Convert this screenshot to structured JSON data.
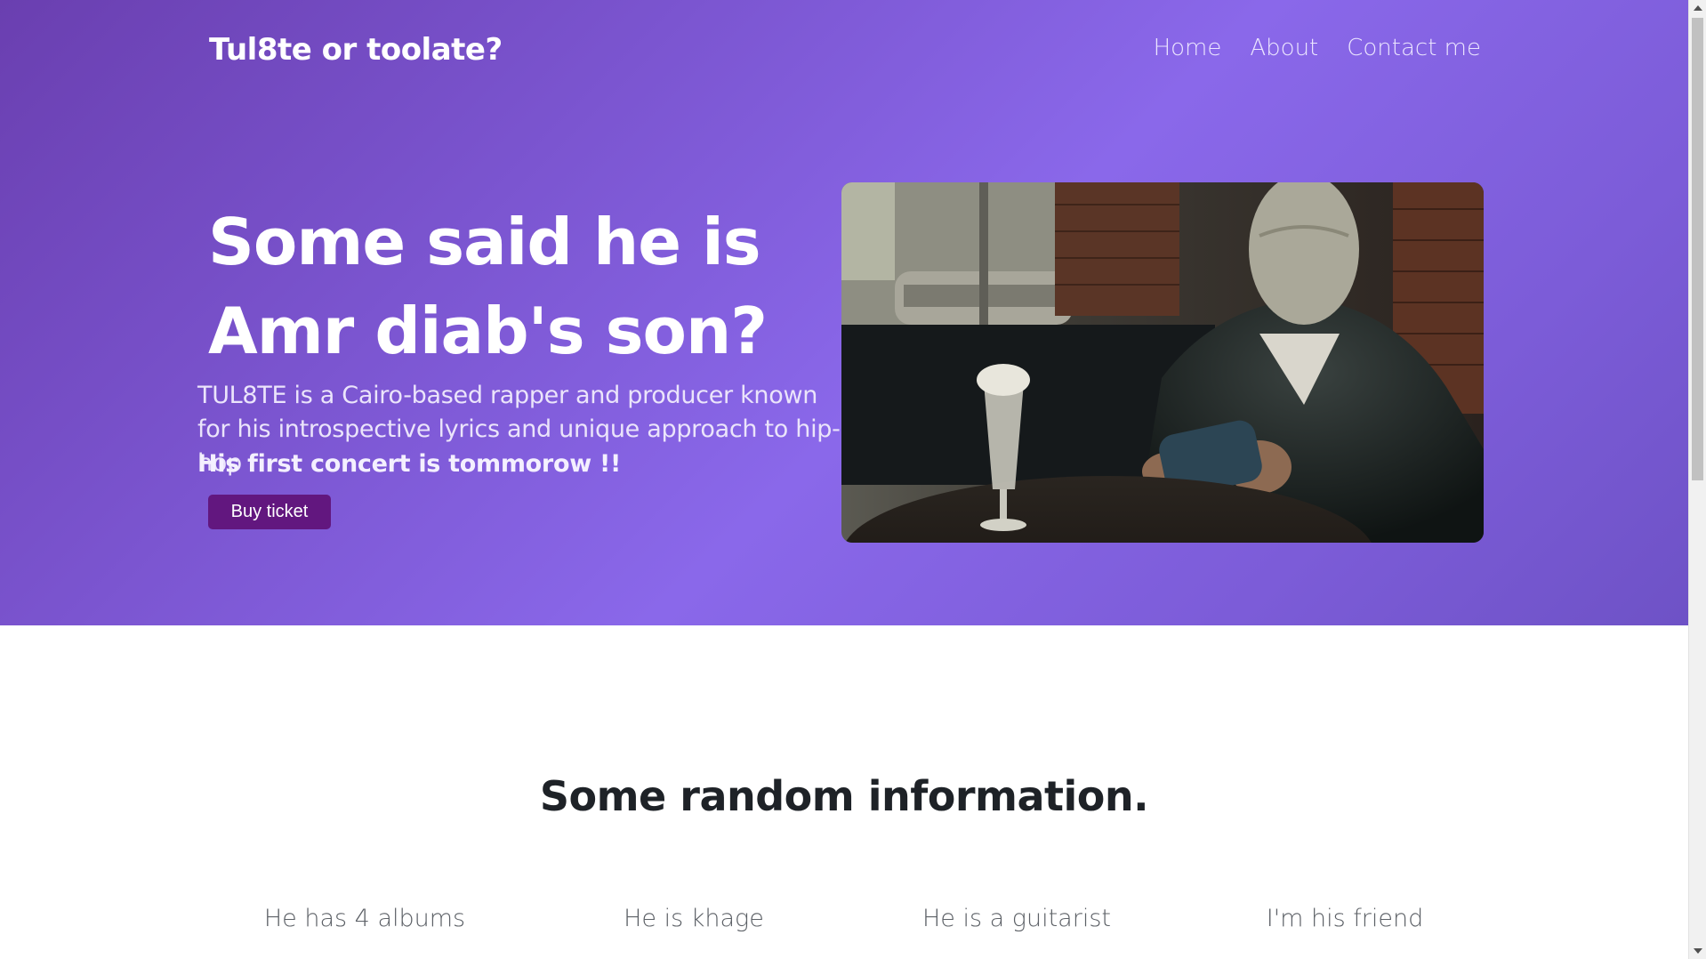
{
  "navbar": {
    "brand": "Tul8te or toolate?",
    "links": [
      "Home",
      "About",
      "Contact me"
    ]
  },
  "hero": {
    "headline_line1": "Some said he is",
    "headline_line2": "Amr diab's son?",
    "description": "TUL8TE is a Cairo-based rapper and producer known for his introspective lyrics and unique approach to hip-hop",
    "highlight": "His first concert is tommorow !!",
    "cta_label": "Buy ticket",
    "image_icon": "photo-masked-man-in-cafe"
  },
  "info": {
    "title": "Some random information.",
    "facts": [
      "He has 4 albums",
      "He is khage",
      "He is a guitarist",
      "I'm his friend"
    ]
  },
  "colors": {
    "hero_gradient_start": "#6a3fb0",
    "hero_gradient_mid": "#8a68ea",
    "button_bg": "#62177f",
    "heading_text": "#1e2227",
    "fact_text": "#5c6066"
  }
}
